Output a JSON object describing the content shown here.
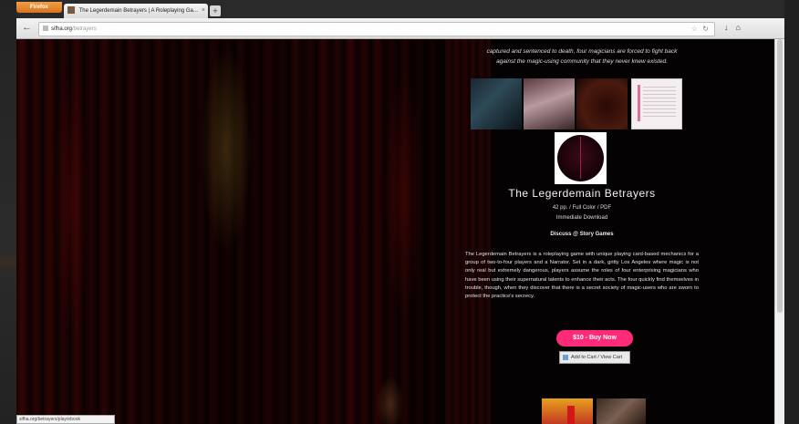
{
  "browser": {
    "menu_label": "Firefox",
    "tab": {
      "title": "The Legerdemain Betrayers | A Roleplaying Ga..."
    },
    "newtab_symbol": "+",
    "url_host": "sifha.org",
    "url_path": "/betrayers",
    "status_text": "sifha.org/betrayers/play/ebook"
  },
  "page": {
    "intro_line1": "captured and sentenced to death, four magicians are forced to fight back",
    "intro_line2": "against the magic-using community that they never knew existed.",
    "game": {
      "title": "The Legerdemain Betrayers",
      "meta_line1": "42 pp. / Full Color / PDF",
      "meta_line2": "Immediate Download",
      "author": "Discuss @ Story Games",
      "description": "The Legerdemain Betrayers is a roleplaying game with unique playing card-based mechanics for a group of two-to-four players and a Narrator. Set in a dark, gritty Los Angeles where magic is not only real but extremely dangerous, players assume the roles of four enterprising magicians who have been using their supernatural talents to enhance their acts. The four quickly find themselves in trouble, though, when they discover that there is a secret society of magic-users who are sworn to protect the practice's secrecy.",
      "buy_label": "$10 - Buy Now",
      "cart_label": "Add to Cart / View Cart"
    }
  }
}
